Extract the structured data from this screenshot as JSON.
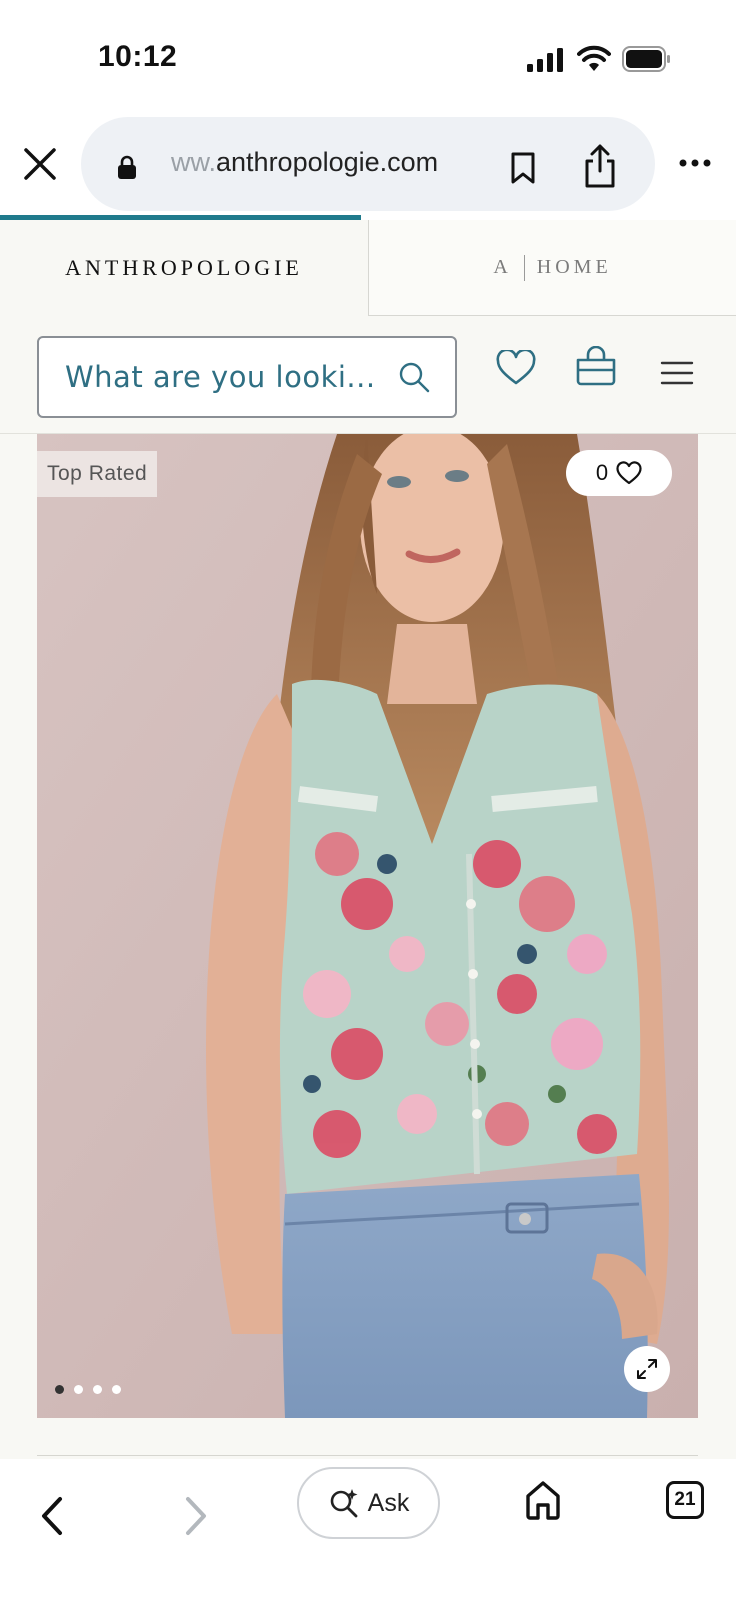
{
  "status_bar": {
    "time": "10:12"
  },
  "browser": {
    "url_faded": "ww.",
    "url_main": "anthropologie.com",
    "page_load_progress": 0.49
  },
  "brand_tabs": [
    {
      "label": "ANTHROPOLOGIE",
      "active": true
    },
    {
      "label_prefix": "A",
      "label": "HOME",
      "active": false
    }
  ],
  "header": {
    "search_placeholder": "What are you looki..."
  },
  "product": {
    "badge": "Top Rated",
    "favorites_count": "0",
    "carousel": {
      "total": 4,
      "active_index": 0
    }
  },
  "toolbar": {
    "ask_label": "Ask",
    "tab_count": "21"
  },
  "colors": {
    "accent": "#1f7a8c",
    "search_text": "#2f6f83",
    "header_bg": "#f8f8f4"
  }
}
